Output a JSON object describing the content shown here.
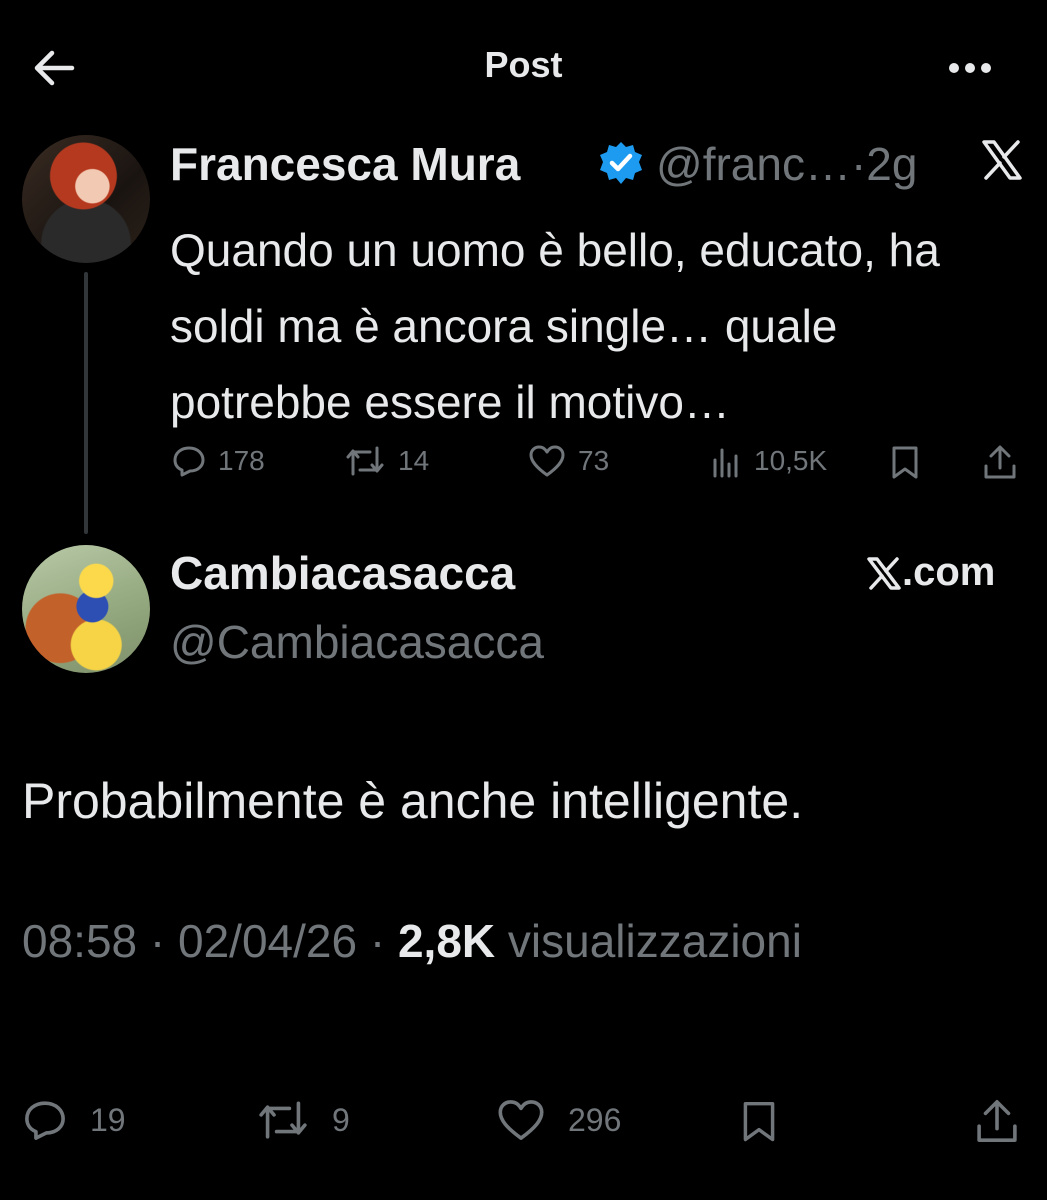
{
  "header": {
    "title": "Post"
  },
  "quoted_post": {
    "author_name": "Francesca Mura",
    "author_handle": "@franc…",
    "time": "·2g",
    "text": "Quando un uomo è bello, educato, ha soldi ma è ancora single… quale potrebbe essere il motivo…",
    "stats": {
      "replies": "178",
      "retweets": "14",
      "likes": "73",
      "views": "10,5K"
    }
  },
  "main_post": {
    "author_name": "Cambiacasacca",
    "author_handle": "@Cambiacasacca",
    "source_badge": ".com",
    "text": "Probabilmente è anche intelligente.",
    "time": "08:58",
    "date": "02/04/26",
    "views_count": "2,8K",
    "views_label": "visualizzazioni",
    "stats": {
      "replies": "19",
      "retweets": "9",
      "likes": "296"
    }
  },
  "colors": {
    "background": "#000000",
    "text": "#e7e9ea",
    "muted": "#71767b",
    "verified": "#1d9bf0"
  },
  "icons": [
    "back-arrow-icon",
    "more-icon",
    "verified-icon",
    "x-logo-icon",
    "reply-icon",
    "retweet-icon",
    "like-icon",
    "views-icon",
    "bookmark-icon",
    "share-icon"
  ]
}
